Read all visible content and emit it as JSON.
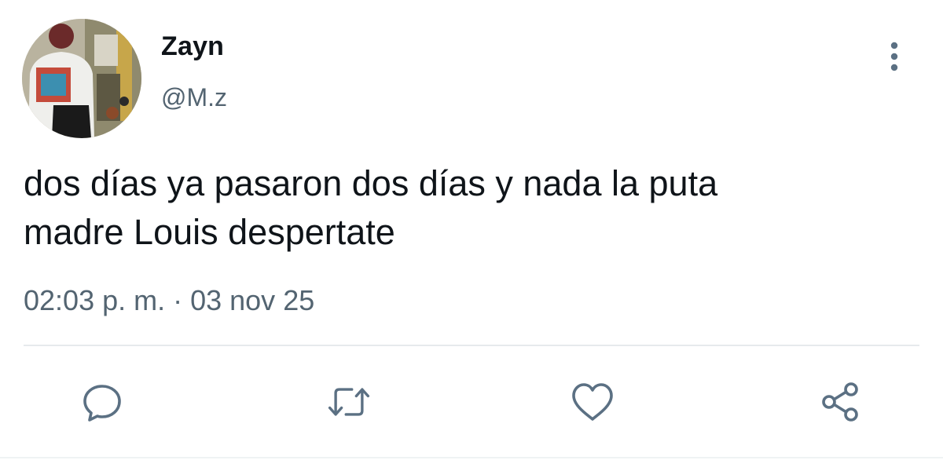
{
  "user": {
    "display_name": "Zayn",
    "handle": "@M.z"
  },
  "tweet": {
    "text_line_1": "dos días ya pasaron dos días y nada la puta",
    "text_line_2": "madre Louis despertate",
    "timestamp": "02:03 p. m. · 03 nov 25"
  },
  "actions": [
    {
      "icon": "reply-icon"
    },
    {
      "icon": "retweet-icon"
    },
    {
      "icon": "like-icon"
    },
    {
      "icon": "share-icon"
    }
  ],
  "menu": {
    "icon": "more-vertical-icon"
  },
  "colors": {
    "text_primary": "#0f1419",
    "text_secondary": "#536471",
    "icon": "#5b7083",
    "divider": "#e6eaed"
  }
}
